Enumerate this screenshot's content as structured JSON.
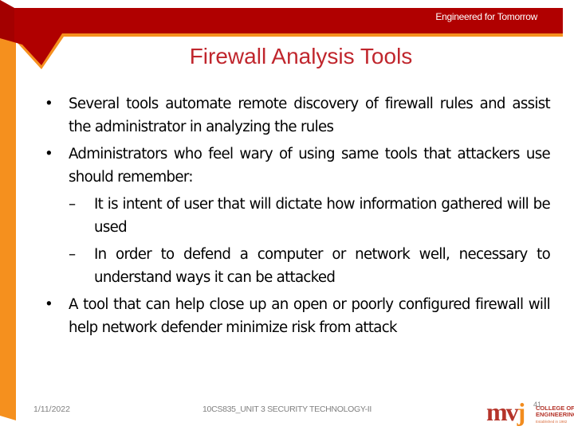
{
  "header": {
    "tagline": "Engineered for Tomorrow"
  },
  "slide": {
    "title": "Firewall Analysis Tools",
    "bullets": [
      {
        "marker": "•",
        "text": "Several tools automate remote discovery of firewall rules and assist the administrator in analyzing the rules"
      },
      {
        "marker": "•",
        "text": "Administrators who feel wary of using same tools that attackers use should remember:",
        "sub": [
          {
            "marker": "–",
            "text": "It is intent of user that will dictate how information gathered will be used"
          },
          {
            "marker": "–",
            "text": "In order to defend a computer or network well, necessary to understand ways it can be attacked"
          }
        ]
      },
      {
        "marker": "•",
        "text": "A tool that can help close up an open or poorly configured firewall will help network defender minimize risk from attack"
      }
    ]
  },
  "footer": {
    "date": "1/11/2022",
    "course": "10CS835_UNIT 3 SECURITY TECHNOLOGY-II",
    "page_number": "41",
    "logo": {
      "mark_m": "mv",
      "mark_j": "j",
      "line1": "COLLEGE OF",
      "line2": "ENGINEERING",
      "sub": "Established in 1982"
    }
  },
  "colors": {
    "header_red": "#b00000",
    "accent_orange": "#f5901e",
    "title_red": "#c0262d",
    "footer_gray": "#808080"
  }
}
